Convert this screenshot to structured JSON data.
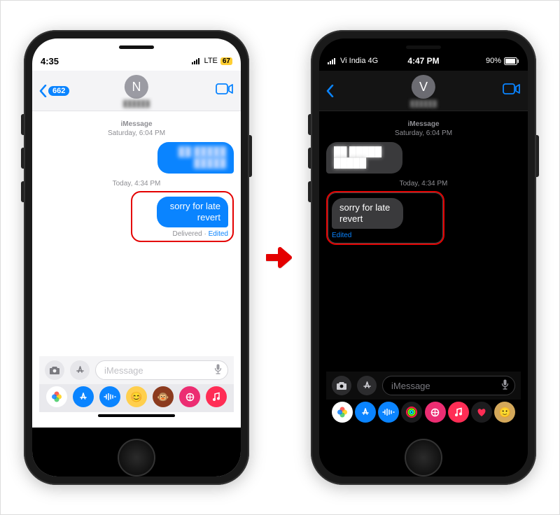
{
  "left": {
    "status": {
      "time": "4:35",
      "net": "LTE",
      "battery": "67"
    },
    "nav": {
      "back_count": "662",
      "avatar_initial": "N",
      "avatar_name": "██████"
    },
    "stamp1_label": "iMessage",
    "stamp1_time": "Saturday, 6:04 PM",
    "bubble1": "██ █████ █████",
    "stamp2_time": "Today, 4:34 PM",
    "bubble2": "sorry for late revert",
    "meta_delivered": "Delivered",
    "meta_sep": " · ",
    "meta_edited": "Edited",
    "compose_placeholder": "iMessage"
  },
  "right": {
    "status": {
      "carrier": "Vi India  4G",
      "time": "4:47 PM",
      "battery": "90%"
    },
    "nav": {
      "avatar_initial": "V",
      "avatar_name": "██████"
    },
    "stamp1_label": "iMessage",
    "stamp1_time": "Saturday, 6:04 PM",
    "bubble1": "██ █████ █████",
    "stamp2_time": "Today, 4:34 PM",
    "bubble2": "sorry for late revert",
    "meta_edited": "Edited",
    "compose_placeholder": "iMessage"
  },
  "dock_colors": {
    "photos": "#ffffff",
    "appstore": "#0a84ff",
    "audio": "#0a84ff",
    "memoji": "#ffcf4d",
    "sticker": "#f97316",
    "web": "#ec2d72",
    "music": "#ff2d55",
    "activity": "#111",
    "heart": "#111",
    "face": "#d4a85a"
  }
}
